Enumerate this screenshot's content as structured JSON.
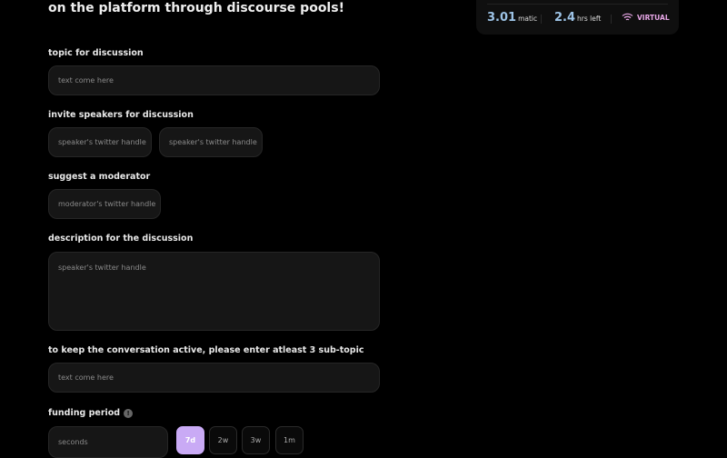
{
  "header": {
    "headline": "on the platform through discourse pools!"
  },
  "stats": {
    "amount": "3.01",
    "amount_unit": "matic",
    "time": "2.4",
    "time_unit": "hrs left",
    "mode": "VIRTUAL",
    "mode_icon": "wifi-icon"
  },
  "form": {
    "topic": {
      "label": "topic for discussion",
      "placeholder": "text come here"
    },
    "speakers": {
      "label": "invite speakers for discussion",
      "placeholders": [
        "speaker's twitter handle",
        "speaker's twitter handle"
      ]
    },
    "moderator": {
      "label": "suggest a moderator",
      "placeholder": "moderator's twitter handle"
    },
    "description": {
      "label": "description for the discussion",
      "placeholder": "speaker's twitter handle"
    },
    "subtopic": {
      "label": "to keep the conversation active, please enter atleast 3 sub-topic",
      "placeholder": "text come here"
    },
    "funding": {
      "label": "funding period",
      "info": "!",
      "placeholder": "seconds",
      "options": [
        "7d",
        "2w",
        "3w",
        "1m"
      ],
      "selected": "7d"
    }
  },
  "colors": {
    "accent": "#c9aaf5",
    "stat": "#9dc3e6",
    "virtual": "#e7a6e6"
  }
}
